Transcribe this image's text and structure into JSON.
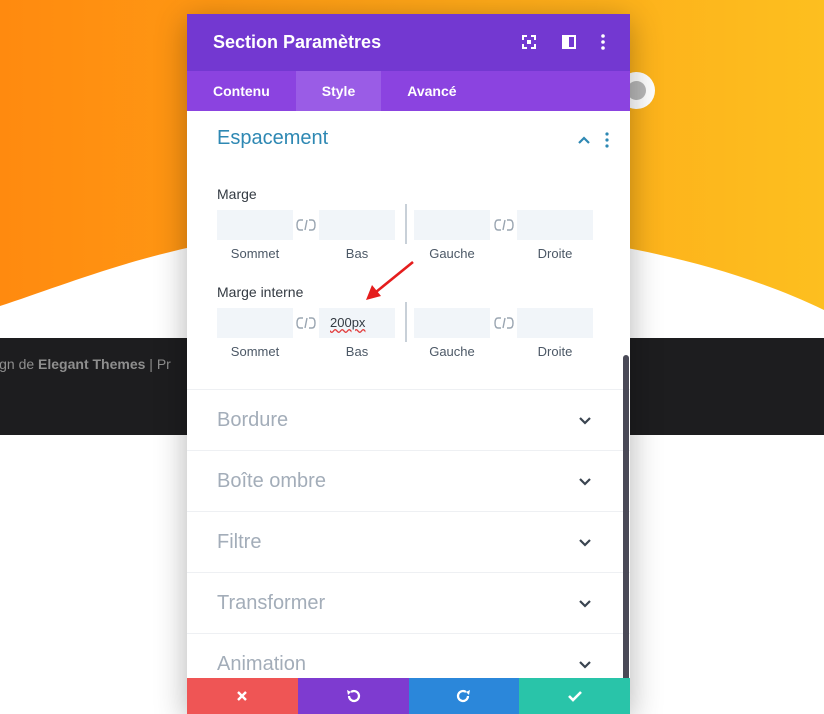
{
  "background": {
    "footer_prefix": "ign de",
    "footer_brand": "Elegant Themes",
    "footer_suffix": " | Pr",
    "colors": {
      "gradient_start": "#ff8a0f",
      "gradient_end": "#fdbf1f",
      "footer_bg": "#1d1d1f"
    }
  },
  "modal": {
    "title": "Section Paramètres",
    "header_icons": [
      "fullscreen-icon",
      "split-view-icon",
      "more-vertical-icon"
    ],
    "tabs": [
      {
        "label": "Contenu",
        "active": false
      },
      {
        "label": "Style",
        "active": true
      },
      {
        "label": "Avancé",
        "active": false
      }
    ],
    "colors": {
      "header": "#7338d1",
      "tabs": "#8b43e0",
      "section_title": "#2e88b3"
    }
  },
  "spacing": {
    "title": "Espacement",
    "margin": {
      "label": "Marge",
      "fields": [
        {
          "label": "Sommet",
          "value": ""
        },
        {
          "label": "Bas",
          "value": ""
        },
        {
          "label": "Gauche",
          "value": ""
        },
        {
          "label": "Droite",
          "value": ""
        }
      ]
    },
    "padding": {
      "label": "Marge interne",
      "fields": [
        {
          "label": "Sommet",
          "value": ""
        },
        {
          "label": "Bas",
          "value": "200px"
        },
        {
          "label": "Gauche",
          "value": ""
        },
        {
          "label": "Droite",
          "value": ""
        }
      ]
    }
  },
  "toggles": [
    "Bordure",
    "Boîte ombre",
    "Filtre",
    "Transformer",
    "Animation"
  ],
  "footer_buttons": {
    "cancel": {
      "icon": "close-icon",
      "color": "#ef5555"
    },
    "undo": {
      "icon": "undo-icon",
      "color": "#7e3bd0"
    },
    "redo": {
      "icon": "redo-icon",
      "color": "#2b87da"
    },
    "save": {
      "icon": "check-icon",
      "color": "#29c4a9"
    }
  }
}
